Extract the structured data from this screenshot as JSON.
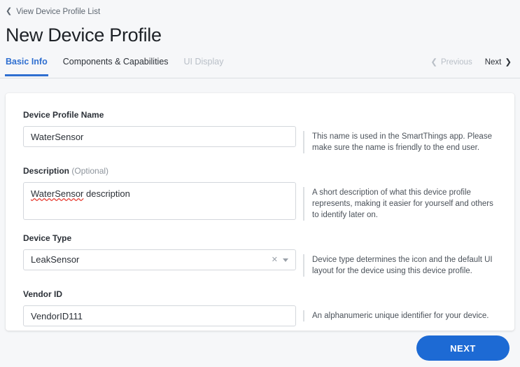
{
  "header": {
    "breadcrumb_label": "View Device Profile List",
    "breadcrumb_icon": "chevron-left-icon",
    "page_title": "New Device Profile"
  },
  "tabs": [
    {
      "label": "Basic Info",
      "state": "active"
    },
    {
      "label": "Components & Capabilities",
      "state": "enabled"
    },
    {
      "label": "UI Display",
      "state": "disabled"
    }
  ],
  "pager": {
    "previous_label": "Previous",
    "previous_icon": "chevron-left-icon",
    "next_label": "Next",
    "next_icon": "chevron-right-icon"
  },
  "form": {
    "fields": [
      {
        "label": "Device Profile Name",
        "optional_label": "",
        "value": "WaterSensor",
        "placeholder": "",
        "hint": "This name is used in the SmartThings app. Please make sure the name is friendly to the end user."
      },
      {
        "label": "Description",
        "optional_label": "(Optional)",
        "value": "WaterSensor description",
        "value_misspelled": "WaterSensor",
        "value_rest": " description",
        "placeholder": "",
        "hint": "A short description of what this device profile represents, making it easier for yourself and others to identify later on."
      },
      {
        "label": "Device Type",
        "optional_label": "",
        "value": "LeakSensor",
        "clear_icon": "close-icon",
        "caret_icon": "chevron-down-icon",
        "hint": "Device type determines the icon and the default UI layout for the device using this device profile."
      },
      {
        "label": "Vendor ID",
        "optional_label": "",
        "value": "VendorID111",
        "placeholder": "",
        "hint": "An alphanumeric unique identifier for your device."
      }
    ]
  },
  "footer": {
    "next_button_label": "NEXT"
  },
  "colors": {
    "accent_blue": "#2f6fd0",
    "button_blue": "#1d6ad4",
    "page_background": "#f6f7f9",
    "card_background": "#ffffff",
    "border": "#d3d7dc",
    "disabled_text": "#b9bfc7",
    "spellcheck_red": "#e8443a"
  }
}
